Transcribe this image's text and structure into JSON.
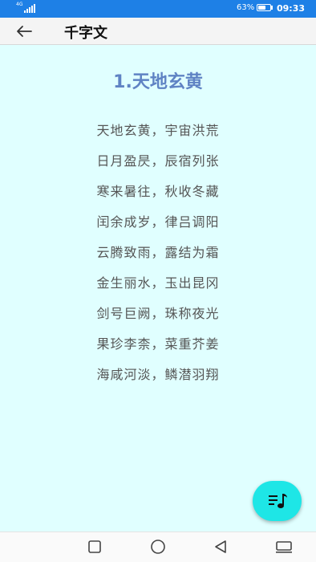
{
  "status_bar": {
    "network_type": "4G",
    "battery_percent": "63%",
    "battery_level": 0.63,
    "time": "09:33",
    "background_color": "#1e80e6"
  },
  "app_bar": {
    "back_icon": "arrow-left-icon",
    "title": "千字文"
  },
  "content": {
    "background_color": "#e0ffff",
    "chapter_title": "1.天地玄黄",
    "title_color": "#5f83c4",
    "verses": [
      "天地玄黄，宇宙洪荒",
      "日月盈昃，辰宿列张",
      "寒来暑往，秋收冬藏",
      "闰余成岁，律吕调阳",
      "云腾致雨，露结为霜",
      "金生丽水，玉出昆冈",
      "剑号巨阙，珠称夜光",
      "果珍李柰，菜重芥姜",
      "海咸河淡，鳞潜羽翔"
    ]
  },
  "fab": {
    "icon": "playlist-music-icon",
    "color": "#1ee6e6"
  },
  "nav_bar": {
    "buttons": [
      "recents-square-icon",
      "home-circle-icon",
      "back-triangle-icon",
      "keyboard-hide-icon"
    ]
  }
}
